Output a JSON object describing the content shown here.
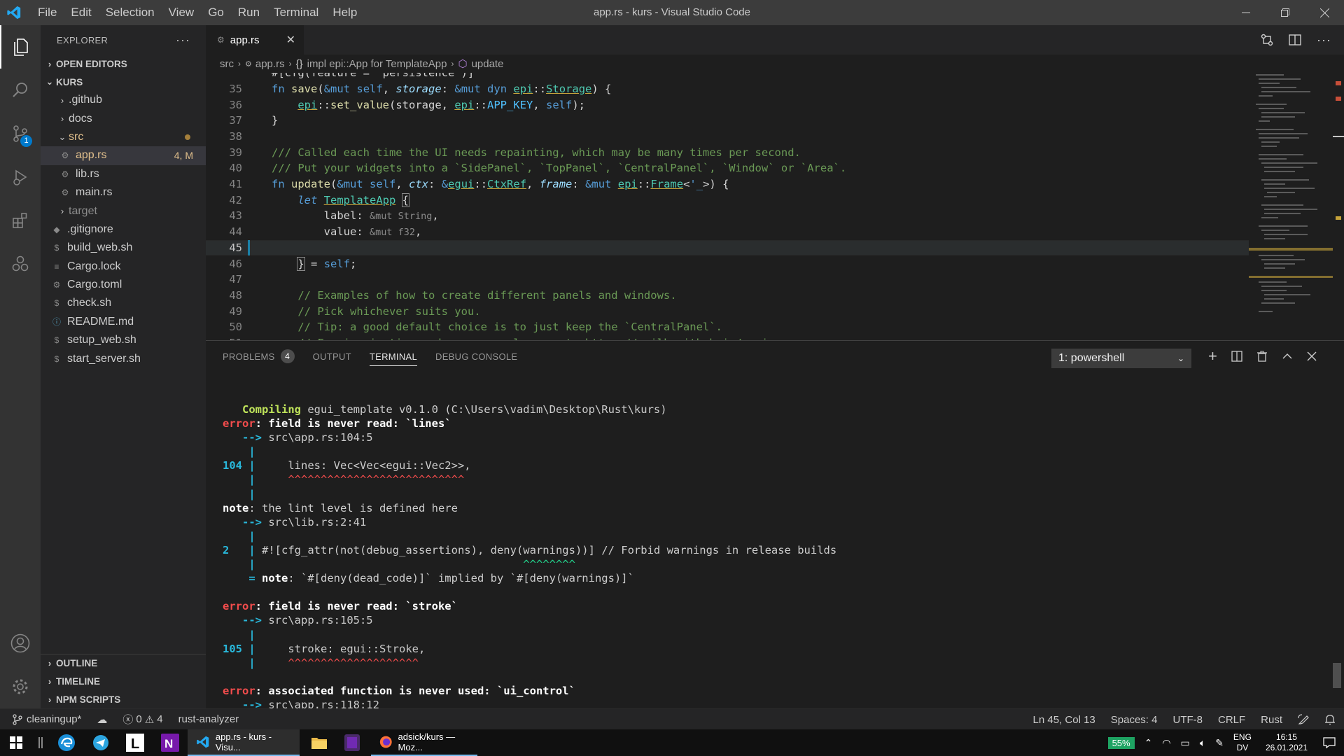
{
  "window": {
    "title": "app.rs - kurs - Visual Studio Code",
    "menu": [
      "File",
      "Edit",
      "Selection",
      "View",
      "Go",
      "Run",
      "Terminal",
      "Help"
    ]
  },
  "activity": {
    "scm_badge": "1"
  },
  "sidebar": {
    "header": "EXPLORER",
    "open_editors": "OPEN EDITORS",
    "root": "KURS",
    "tree": [
      {
        "label": ".github",
        "kind": "folder"
      },
      {
        "label": "docs",
        "kind": "folder"
      },
      {
        "label": "src",
        "kind": "folder-open"
      },
      {
        "label": "app.rs",
        "kind": "file",
        "meta": "4, M"
      },
      {
        "label": "lib.rs",
        "kind": "file"
      },
      {
        "label": "main.rs",
        "kind": "file"
      },
      {
        "label": "target",
        "kind": "folder"
      },
      {
        "label": ".gitignore",
        "kind": "file"
      },
      {
        "label": "build_web.sh",
        "kind": "file"
      },
      {
        "label": "Cargo.lock",
        "kind": "file"
      },
      {
        "label": "Cargo.toml",
        "kind": "file"
      },
      {
        "label": "check.sh",
        "kind": "file"
      },
      {
        "label": "README.md",
        "kind": "file"
      },
      {
        "label": "setup_web.sh",
        "kind": "file"
      },
      {
        "label": "start_server.sh",
        "kind": "file"
      }
    ],
    "outline": "OUTLINE",
    "timeline": "TIMELINE",
    "npm": "NPM SCRIPTS"
  },
  "editor": {
    "tab": "app.rs",
    "breadcrumb": [
      "src",
      "app.rs",
      "impl epi::App for TemplateApp",
      "update"
    ],
    "line_numbers": [
      "35",
      "36",
      "37",
      "38",
      "39",
      "40",
      "41",
      "42",
      "43",
      "44",
      "45",
      "46",
      "47",
      "48",
      "49",
      "50"
    ]
  },
  "panel": {
    "tabs": [
      "PROBLEMS",
      "OUTPUT",
      "TERMINAL",
      "DEBUG CONSOLE"
    ],
    "problems_count": "4",
    "terminal_select": "1: powershell"
  },
  "status": {
    "branch": "cleaningup*",
    "errors": "0",
    "warnings": "4",
    "analyzer": "rust-analyzer",
    "position": "Ln 45, Col 13",
    "spaces": "Spaces: 4",
    "encoding": "UTF-8",
    "eol": "CRLF",
    "language": "Rust"
  },
  "taskbar": {
    "vscode_label": "app.rs - kurs - Visu...",
    "firefox_label": "adsick/kurs — Moz...",
    "battery": "55%",
    "lang_top": "ENG",
    "lang_bottom": "DV",
    "time": "16:15",
    "date": "26.01.2021"
  },
  "colors": {
    "accent": "#007acc",
    "status_bg": "#252526",
    "titlebar": "#3c3c3c"
  }
}
